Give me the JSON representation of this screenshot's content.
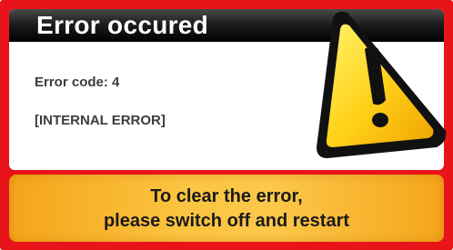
{
  "dialog": {
    "title": "Error occured",
    "error_code": "Error code: 4",
    "error_type": "[INTERNAL ERROR]",
    "icon": "warning-triangle-icon"
  },
  "instructions": {
    "line1": "To clear the error,",
    "line2": "please switch off and restart"
  },
  "colors": {
    "frame": "#e8141a",
    "header": "#000000",
    "action_box": "#fbc440",
    "icon_fill": "#ffd21a"
  }
}
